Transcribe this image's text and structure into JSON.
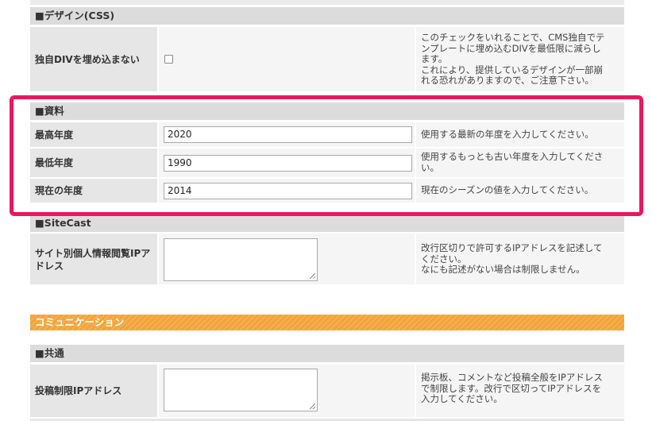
{
  "colors": {
    "highlight": "#e8185e",
    "band": "#f2a43a"
  },
  "design": {
    "header": "■デザイン(CSS)",
    "row": {
      "label": "独自DIVを埋め込まない",
      "checked": false,
      "desc": [
        "このチェックをいれることで、CMS独自でテ",
        "ンプレートに埋め込むDIVを最低限に減らし",
        "ます。",
        "これにより、提供しているデザインが一部崩",
        "れる恐れがありますので、ご注意下さい。"
      ]
    }
  },
  "shiryo": {
    "header": "■資料",
    "rows": [
      {
        "label": "最高年度",
        "value": "2020",
        "desc": [
          "使用する最新の年度を入力してください。"
        ]
      },
      {
        "label": "最低年度",
        "value": "1990",
        "desc": [
          "使用するもっとも古い年度を入力してくださ",
          "い。"
        ]
      },
      {
        "label": "現在の年度",
        "value": "2014",
        "desc": [
          "現在のシーズンの値を入力してください。"
        ]
      }
    ]
  },
  "sitecast": {
    "header": "■SiteCast",
    "row": {
      "label": [
        "サイト別個人情報閲覧IPア",
        "ドレス"
      ],
      "value": "",
      "desc": [
        "改行区切りで許可するIPアドレスを記述して",
        "ください。",
        "なにも記述がない場合は制限しません。"
      ]
    }
  },
  "communication": {
    "band": "コミュニケーション",
    "header": "■共通",
    "row": {
      "label": "投稿制限IPアドレス",
      "value": "",
      "desc": [
        "掲示板、コメントなど投稿全般をIPアドレス",
        "で制限します。改行で区切ってIPアドレスを",
        "入力してください。"
      ]
    }
  }
}
